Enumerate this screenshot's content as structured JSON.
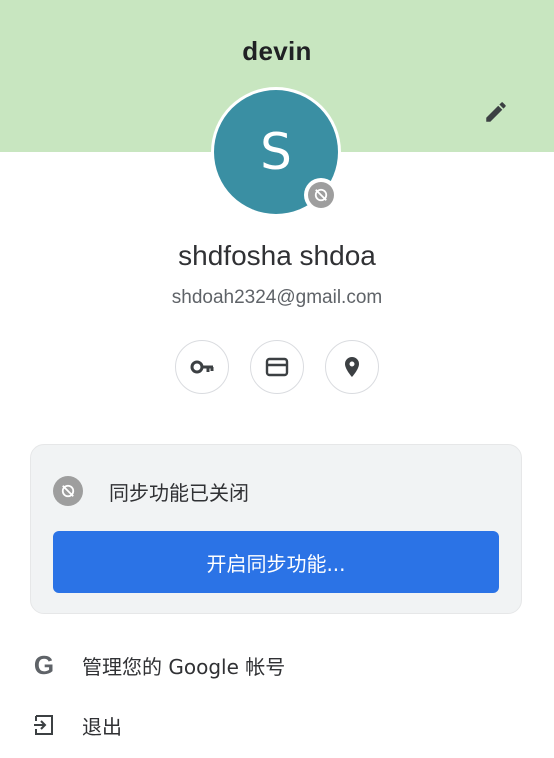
{
  "profile": {
    "label": "devin",
    "avatar_initial": "S",
    "full_name": "shdfosha shdoa",
    "email": "shdoah2324@gmail.com"
  },
  "quick_actions": [
    {
      "icon": "key-icon"
    },
    {
      "icon": "credit-card-icon"
    },
    {
      "icon": "location-pin-icon"
    }
  ],
  "sync": {
    "status_text": "同步功能已关闭",
    "turn_on_label": "开启同步功能..."
  },
  "menu": {
    "manage_account_label": "管理您的 Google 帐号",
    "manage_account_icon_text": "G",
    "sign_out_label": "退出"
  },
  "colors": {
    "header_bg": "#c8e6c0",
    "avatar_bg": "#3a8fa3",
    "primary_button": "#2b73e6"
  }
}
